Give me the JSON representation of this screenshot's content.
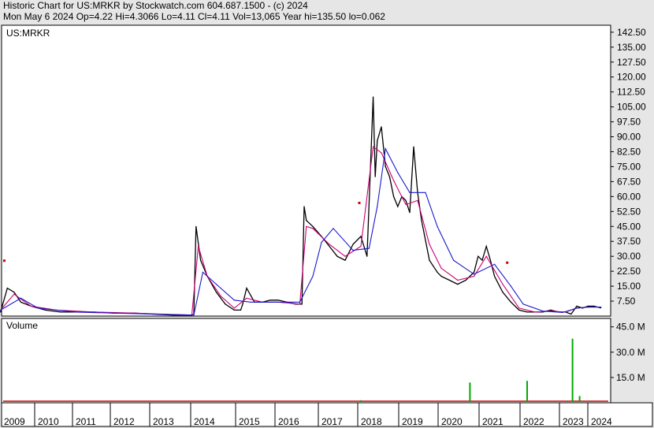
{
  "header": {
    "line1": "Historic Chart for US:MRKR by Stockwatch.com 604.687.1500 - (c) 2024",
    "line2": "Mon May  6 2024   Op=4.22   Hi=4.3066   Lo=4.11   Cl=4.11   Vol=13,065   Year hi=135.50   lo=0.062"
  },
  "chart_data": [
    {
      "type": "line",
      "title": "US:MRKR",
      "ylim": [
        0,
        146
      ],
      "y_ticks": [
        "142.50",
        "135.00",
        "127.50",
        "120.00",
        "112.50",
        "105.00",
        "97.50",
        "90.00",
        "82.50",
        "75.00",
        "67.50",
        "60.00",
        "52.50",
        "45.00",
        "37.50",
        "30.00",
        "22.50",
        "15.00",
        "7.50"
      ],
      "x_ticks": [
        "2009",
        "2010",
        "2011",
        "2012",
        "2013",
        "2014",
        "2015",
        "2016",
        "2017",
        "2018",
        "2019",
        "2020",
        "2021",
        "2022",
        "2023",
        "2024"
      ],
      "grid": false,
      "colors": {
        "price": "#000000",
        "ma_short": "#cc0077",
        "ma_long": "#1a1acc",
        "marker": "#cc0000"
      },
      "series": [
        {
          "x": [
            2008.9,
            2009.1,
            2009.3,
            2009.5,
            2009.8,
            2010.2,
            2010.6,
            2011.0,
            2011.5,
            2012.0,
            2012.5,
            2013.0,
            2013.5,
            2013.95,
            2014.0,
            2014.05,
            2014.15,
            2014.3,
            2014.5,
            2014.7,
            2014.9,
            2015.05,
            2015.1,
            2015.2,
            2015.4,
            2015.6,
            2015.8,
            2016.0,
            2016.2,
            2016.4,
            2016.55,
            2016.6,
            2016.65,
            2016.8,
            2017.0,
            2017.2,
            2017.4,
            2017.6,
            2017.8,
            2018.0,
            2018.15,
            2018.3,
            2018.35,
            2018.4,
            2018.5,
            2018.6,
            2018.7,
            2018.8,
            2018.9,
            2019.0,
            2019.1,
            2019.2,
            2019.3,
            2019.4,
            2019.5,
            2019.6,
            2019.7,
            2019.8,
            2019.9,
            2020.0,
            2020.2,
            2020.4,
            2020.6,
            2020.8,
            2020.9,
            2021.0,
            2021.1,
            2021.2,
            2021.3,
            2021.5,
            2021.7,
            2021.9,
            2022.1,
            2022.3,
            2022.5,
            2022.7,
            2022.9,
            2023.1,
            2023.3,
            2023.5,
            2023.7,
            2023.9,
            2024.1,
            2024.35
          ],
          "y": [
            2,
            14,
            12,
            7,
            5,
            3,
            2,
            2,
            2,
            1.5,
            1.5,
            1,
            0.5,
            0.5,
            1,
            45,
            28,
            20,
            12,
            6,
            3,
            3,
            6,
            14,
            7,
            7,
            8,
            8,
            7,
            6,
            6,
            55,
            48,
            45,
            40,
            35,
            30,
            28,
            36,
            40,
            30,
            110,
            70,
            88,
            95,
            75,
            70,
            60,
            55,
            60,
            58,
            52,
            85,
            62,
            48,
            38,
            28,
            25,
            22,
            20,
            18,
            16,
            18,
            22,
            30,
            28,
            35,
            28,
            20,
            12,
            7,
            3,
            2,
            2,
            2,
            3,
            2,
            2,
            1,
            5,
            4,
            5,
            5,
            4.11
          ]
        },
        {
          "x": [
            2008.9,
            2009.3,
            2009.8,
            2010.5,
            2011.5,
            2012.5,
            2013.5,
            2013.95,
            2014.1,
            2014.3,
            2014.6,
            2014.9,
            2015.2,
            2015.6,
            2016.0,
            2016.5,
            2016.65,
            2016.8,
            2017.2,
            2017.6,
            2018.0,
            2018.3,
            2018.5,
            2018.8,
            2019.1,
            2019.4,
            2019.7,
            2020.0,
            2020.4,
            2020.8,
            2021.1,
            2021.5,
            2021.9,
            2022.3,
            2022.7,
            2023.1,
            2023.5,
            2023.9,
            2024.35
          ],
          "y": [
            3,
            11,
            5,
            3,
            2,
            1.5,
            0.8,
            0.5,
            35,
            20,
            10,
            4,
            9,
            7,
            7,
            6,
            45,
            44,
            36,
            30,
            35,
            85,
            82,
            68,
            56,
            58,
            36,
            24,
            18,
            20,
            30,
            16,
            4,
            2,
            2.5,
            2,
            4,
            4.5,
            4.5
          ]
        },
        {
          "x": [
            2008.9,
            2009.5,
            2010.0,
            2011.0,
            2012.0,
            2013.0,
            2014.0,
            2014.2,
            2014.5,
            2014.9,
            2015.3,
            2015.8,
            2016.5,
            2016.8,
            2017.0,
            2017.3,
            2017.8,
            2018.2,
            2018.4,
            2018.6,
            2018.9,
            2019.2,
            2019.6,
            2019.9,
            2020.3,
            2020.8,
            2021.3,
            2021.7,
            2022.0,
            2022.5,
            2023.0,
            2023.5,
            2023.9,
            2024.35
          ],
          "y": [
            3,
            9,
            4,
            2,
            1.5,
            1,
            0.5,
            22,
            16,
            8,
            7,
            7,
            7,
            20,
            37,
            44,
            33,
            34,
            55,
            84,
            72,
            62,
            62,
            45,
            28,
            21,
            26,
            15,
            6,
            2.5,
            1.8,
            4,
            4.5,
            4.5
          ]
        }
      ],
      "markers": [
        {
          "x": 2009.0,
          "y": 28
        },
        {
          "x": 2017.95,
          "y": 57
        },
        {
          "x": 2021.6,
          "y": 27
        }
      ]
    },
    {
      "type": "bar",
      "title": "Volume",
      "ylim": [
        0,
        50
      ],
      "y_ticks": [
        "45.0 M",
        "30.0 M",
        "15.0 M"
      ],
      "tick_values": [
        45,
        30,
        15
      ],
      "colors": {
        "up": "#00aa00",
        "down": "#cc0000"
      },
      "x": [
        2013.55,
        2018.0,
        2020.7,
        2022.1,
        2022.8,
        2023.15,
        2023.35,
        2023.6,
        2024.0
      ],
      "values": [
        1.0,
        1.5,
        12.0,
        13.0,
        1.0,
        1.0,
        38.0,
        4.0,
        1.0
      ]
    }
  ]
}
